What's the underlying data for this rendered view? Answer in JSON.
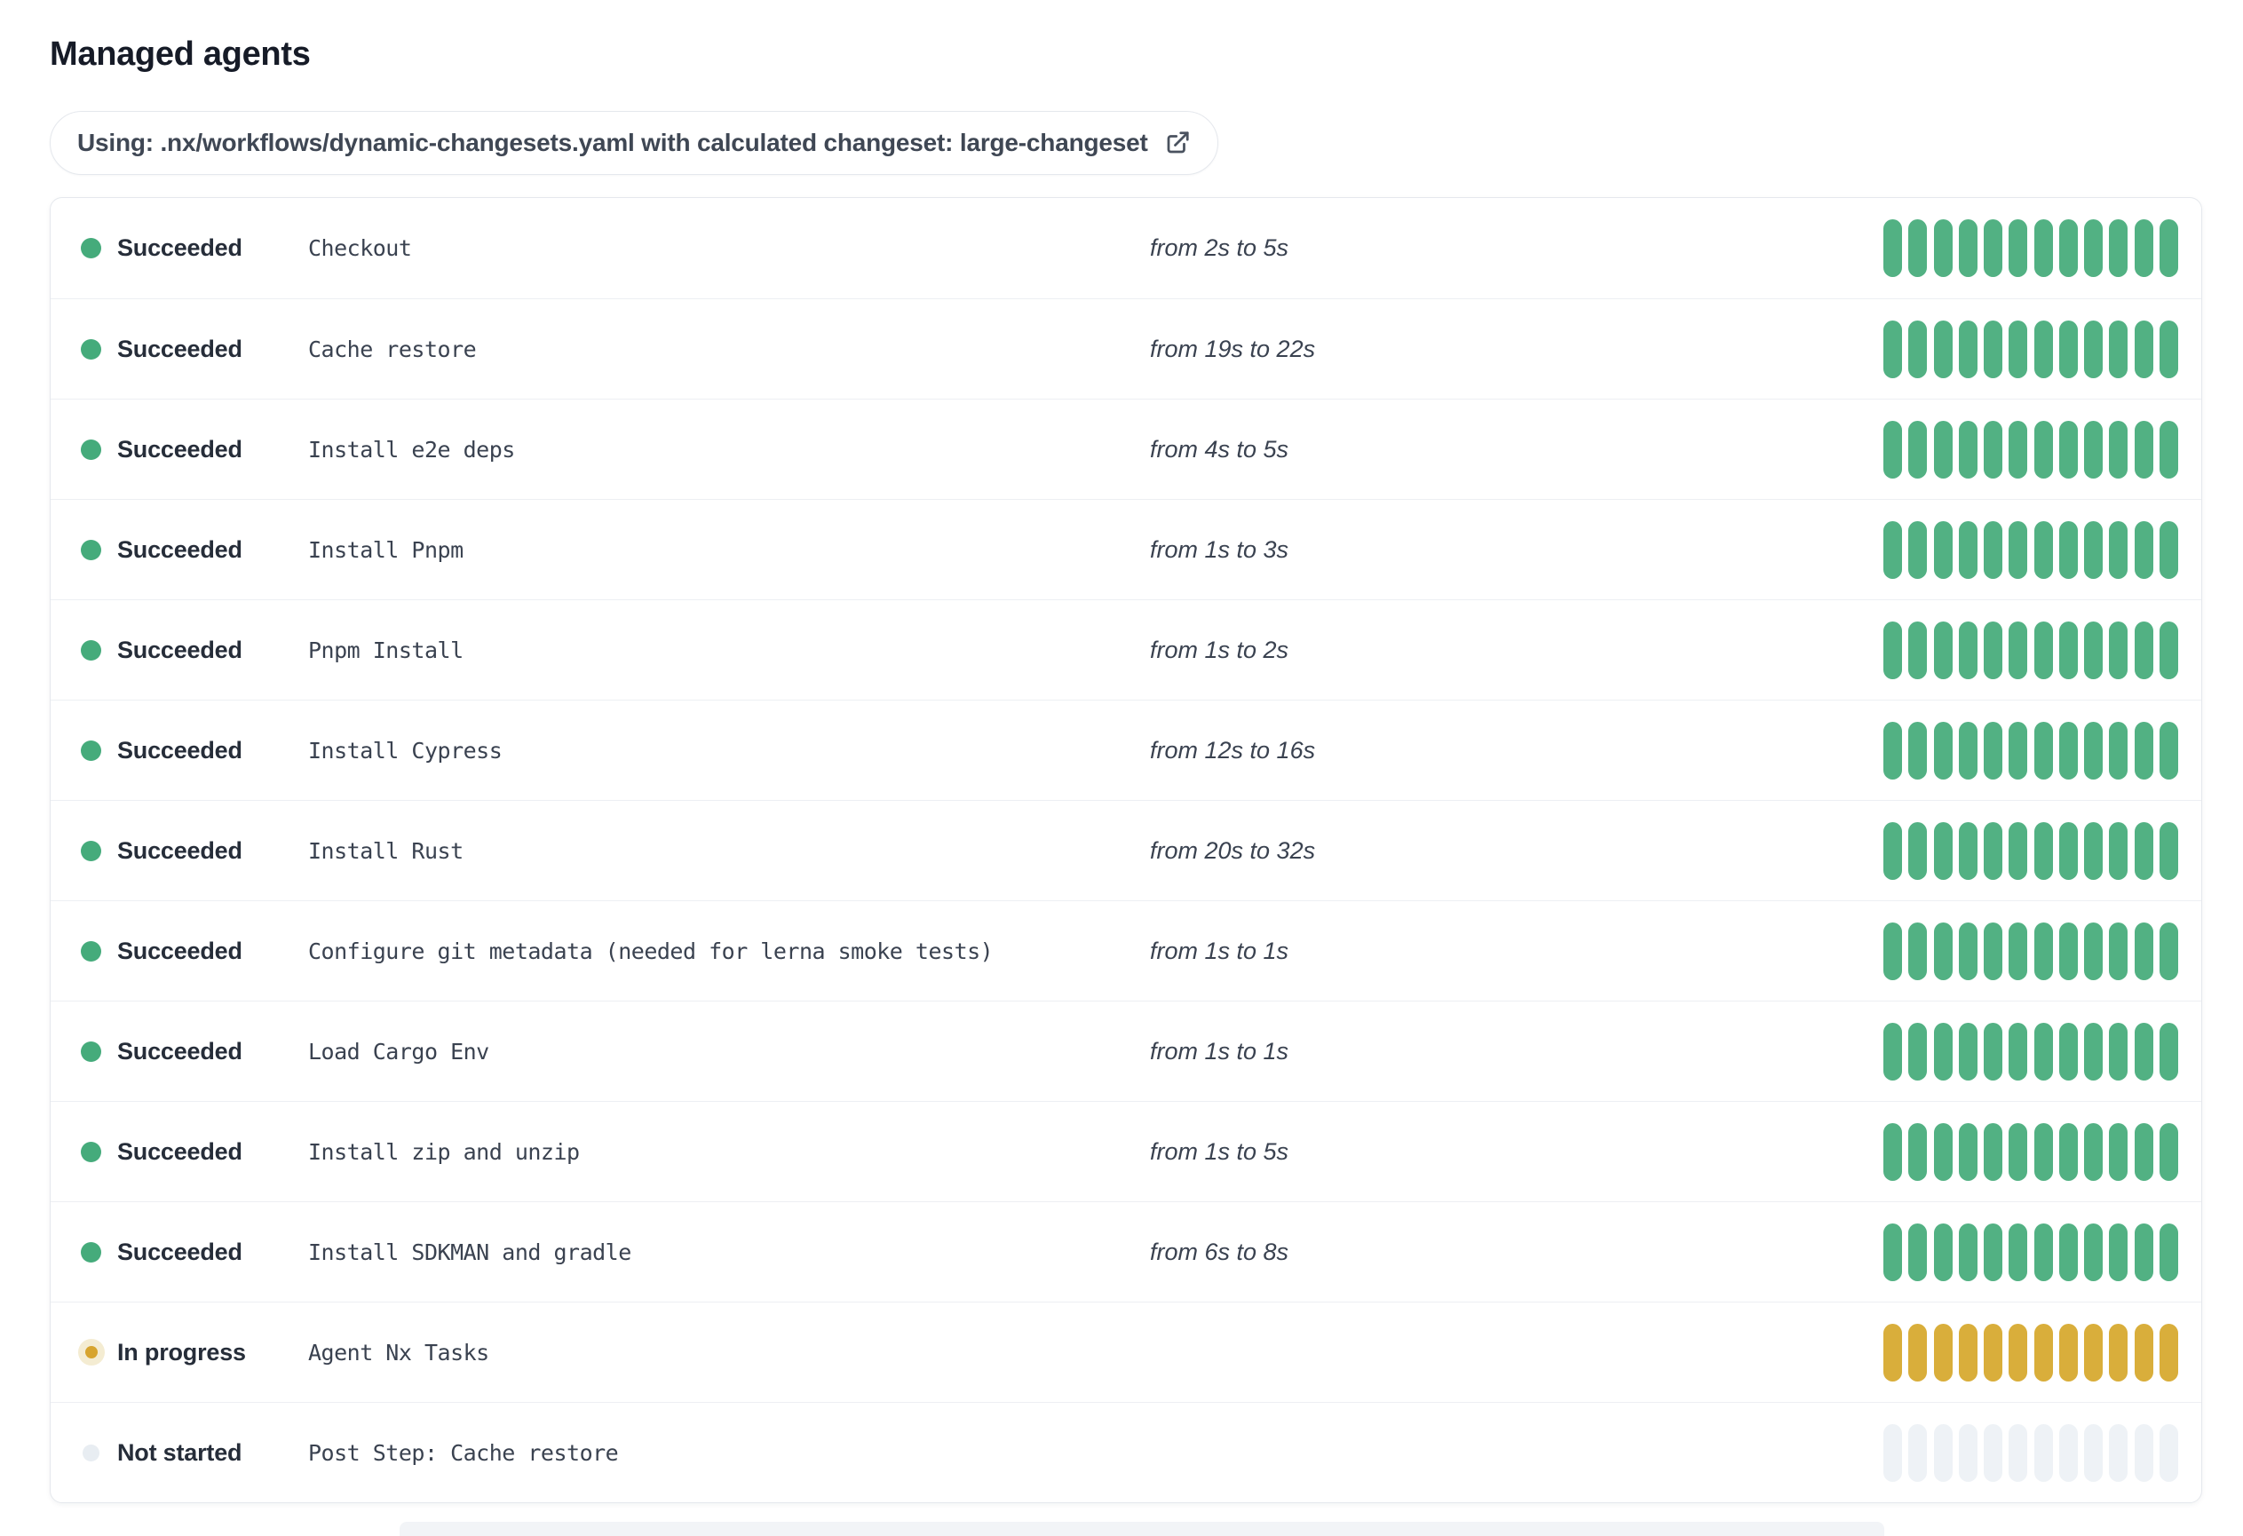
{
  "page": {
    "title": "Managed agents"
  },
  "banner": {
    "text": "Using: .nx/workflows/dynamic-changesets.yaml with calculated changeset: large-changeset",
    "icon": "external-link-icon"
  },
  "colors": {
    "succeeded": "#52b183",
    "succeeded-dot": "#45ab7b",
    "in-progress": "#d9ae3b",
    "in-progress-dot": "#d7a42e",
    "in-progress-halo": "#f4ecd2",
    "not-started": "#eef2f6",
    "not-started-dot": "#e8edf2",
    "border": "#e5e8ed",
    "separator": "#edeff3"
  },
  "steps": [
    {
      "status": "succeeded",
      "status_label": "Succeeded",
      "name": "Checkout",
      "duration": "from 2s to 5s",
      "segments": 12
    },
    {
      "status": "succeeded",
      "status_label": "Succeeded",
      "name": "Cache restore",
      "duration": "from 19s to 22s",
      "segments": 12
    },
    {
      "status": "succeeded",
      "status_label": "Succeeded",
      "name": "Install e2e deps",
      "duration": "from 4s to 5s",
      "segments": 12
    },
    {
      "status": "succeeded",
      "status_label": "Succeeded",
      "name": "Install Pnpm",
      "duration": "from 1s to 3s",
      "segments": 12
    },
    {
      "status": "succeeded",
      "status_label": "Succeeded",
      "name": "Pnpm Install",
      "duration": "from 1s to 2s",
      "segments": 12
    },
    {
      "status": "succeeded",
      "status_label": "Succeeded",
      "name": "Install Cypress",
      "duration": "from 12s to 16s",
      "segments": 12
    },
    {
      "status": "succeeded",
      "status_label": "Succeeded",
      "name": "Install Rust",
      "duration": "from 20s to 32s",
      "segments": 12
    },
    {
      "status": "succeeded",
      "status_label": "Succeeded",
      "name": "Configure git metadata (needed for lerna smoke tests)",
      "duration": "from 1s to 1s",
      "segments": 12
    },
    {
      "status": "succeeded",
      "status_label": "Succeeded",
      "name": "Load Cargo Env",
      "duration": "from 1s to 1s",
      "segments": 12
    },
    {
      "status": "succeeded",
      "status_label": "Succeeded",
      "name": "Install zip and unzip",
      "duration": "from 1s to 5s",
      "segments": 12
    },
    {
      "status": "succeeded",
      "status_label": "Succeeded",
      "name": "Install SDKMAN and gradle",
      "duration": "from 6s to 8s",
      "segments": 12
    },
    {
      "status": "in-progress",
      "status_label": "In progress",
      "name": "Agent Nx Tasks",
      "segments": 12
    },
    {
      "status": "not-started",
      "status_label": "Not started",
      "name": "Post Step: Cache restore",
      "segments": 12
    }
  ]
}
